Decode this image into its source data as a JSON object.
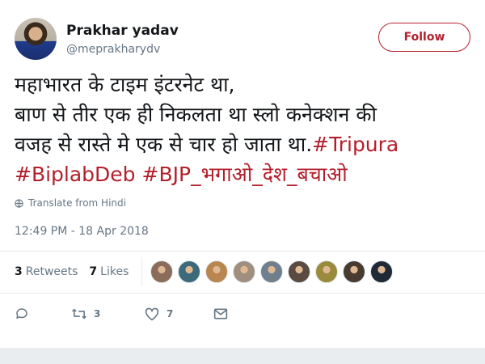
{
  "user": {
    "name": "Prakhar yadav",
    "handle": "@meprakharydv"
  },
  "follow_label": "Follow",
  "tweet": {
    "line1": "महाभारत के टाइम इंटरनेट था,",
    "line2": "बाण से तीर एक ही निकलता था स्लो कनेक्शन की",
    "line3_text": "वजह से रास्ते मे एक से चार हो जाता था.",
    "hashtag1": "#Tripura",
    "hashtag2": "#BiplabDeb",
    "hashtag3": "#BJP_भगाओ_देश_बचाओ"
  },
  "translate_label": "Translate from Hindi",
  "timestamp": "12:49 PM - 18 Apr 2018",
  "stats": {
    "retweets_count": "3",
    "retweets_label": "Retweets",
    "likes_count": "7",
    "likes_label": "Likes"
  },
  "liker_avatars": [
    "#8b6b5a",
    "#3c6a7a",
    "#b8864e",
    "#a08f7e",
    "#6f7f8d",
    "#5a4a3f",
    "#9a8a3c",
    "#4a3b30",
    "#1f2a36"
  ],
  "actions": {
    "reply_icon": "reply-icon",
    "retweet_count": "3",
    "like_count": "7",
    "message_icon": "envelope-icon"
  },
  "colors": {
    "accent": "#b3202c",
    "muted": "#657786",
    "text": "#14171a"
  }
}
